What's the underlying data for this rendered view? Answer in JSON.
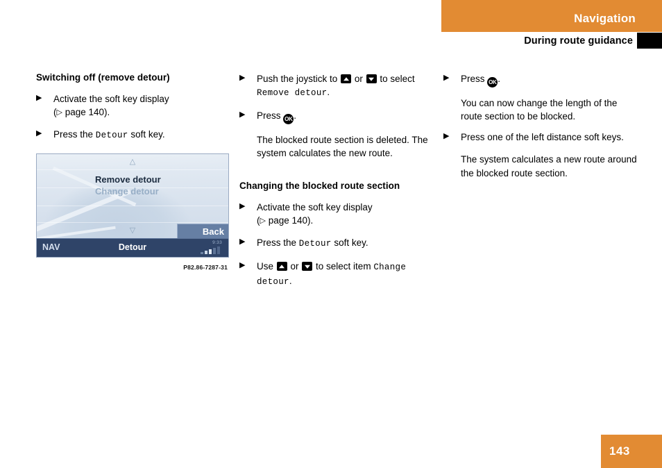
{
  "header": {
    "chapter": "Navigation",
    "section": "During route guidance",
    "orange_color": "#E28B33"
  },
  "footer": {
    "page_number": "143"
  },
  "left_column": {
    "subhead": "Switching off (remove detour)",
    "steps": [
      {
        "marker": "▶",
        "text_before": "Activate the soft key display",
        "reference_prefix": "(",
        "reference_triangle": "▷",
        "reference_text": " page 140).",
        "text_after": ""
      },
      {
        "marker": "▶",
        "text_before": "Press the ",
        "mono": "Detour",
        "text_after": " soft key."
      }
    ],
    "figure": {
      "caption": "P82.86-7287-31",
      "scroll_up": "△",
      "scroll_down": "▽",
      "menu_items": [
        {
          "label": "Remove detour",
          "state": "selected"
        },
        {
          "label": "Change detour",
          "state": "dimmed"
        }
      ],
      "soft_key_back": "Back",
      "status_mode": "NAV",
      "status_title": "Detour",
      "status_clock": "9:33"
    }
  },
  "middle_column": {
    "steps": [
      {
        "marker": "▶",
        "text_1": "Push the joystick to ",
        "key_1": "up-arrow-key",
        "text_2": " or ",
        "key_2": "down-arrow-key",
        "text_3": " to select ",
        "mono": "Remove detour",
        "text_4": "."
      },
      {
        "marker": "▶",
        "text_1": "Press ",
        "key_1": "ok-key",
        "text_2": "."
      }
    ],
    "result_paragraph": "The blocked route section is deleted. The system calculates the new route.",
    "subhead": "Changing the blocked route section",
    "steps2": [
      {
        "marker": "▶",
        "text_before": "Activate the soft key display",
        "reference_prefix": "(",
        "reference_triangle": "▷",
        "reference_text": " page 140)."
      },
      {
        "marker": "▶",
        "text_before": "Press the ",
        "mono": "Detour",
        "text_after": " soft key."
      },
      {
        "marker": "▶",
        "text_1": "Use ",
        "key_1": "up-arrow-key",
        "text_2": " or ",
        "key_2": "down-arrow-key",
        "text_3": " to select item ",
        "mono": "Change detour",
        "text_4": "."
      }
    ]
  },
  "right_column": {
    "steps": [
      {
        "marker": "▶",
        "text_1": "Press ",
        "key_1": "ok-key",
        "text_2": "."
      }
    ],
    "result_paragraph_1": "You can now change the length of the route section to be blocked.",
    "step_2": {
      "marker": "▶",
      "text": "Press one of the left distance soft keys."
    },
    "result_paragraph_2": "The system calculates a new route around the blocked route section."
  },
  "keys": {
    "ok_label": "OK"
  }
}
